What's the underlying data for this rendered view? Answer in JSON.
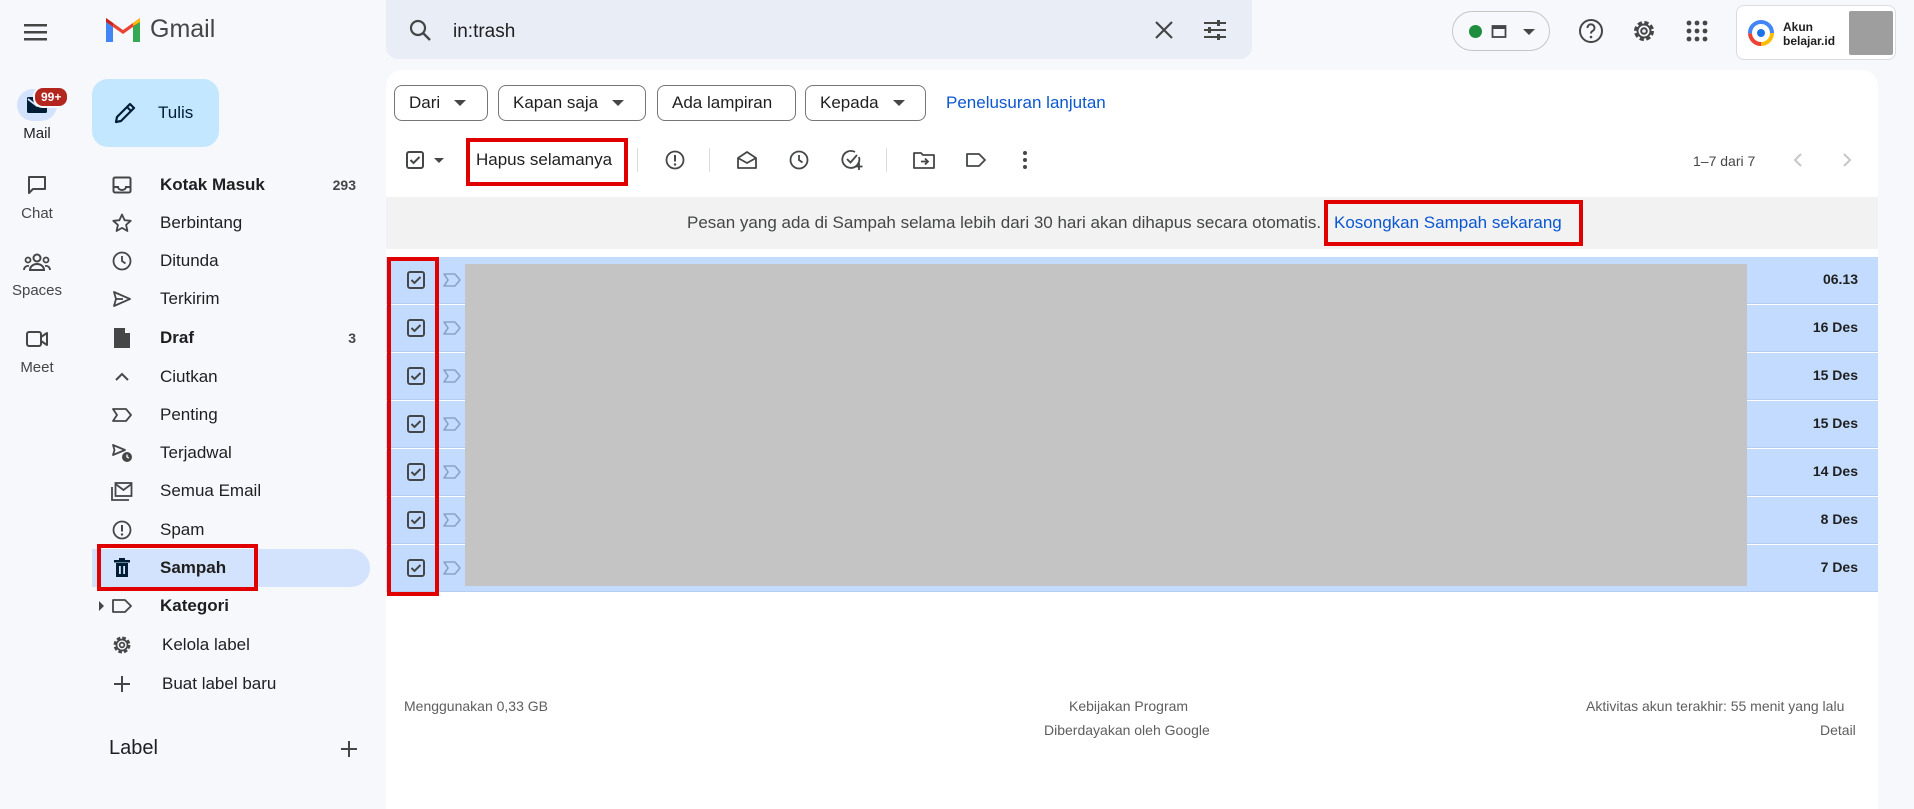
{
  "app": {
    "logo_text": "Gmail"
  },
  "search": {
    "value": "in:trash"
  },
  "account": {
    "line1": "Akun",
    "line2": "belajar.id"
  },
  "rail": [
    {
      "label": "Mail",
      "icon": "mail-icon",
      "badge": "99+"
    },
    {
      "label": "Chat",
      "icon": "chat-icon"
    },
    {
      "label": "Spaces",
      "icon": "spaces-icon"
    },
    {
      "label": "Meet",
      "icon": "meet-icon"
    }
  ],
  "compose": {
    "label": "Tulis"
  },
  "nav": {
    "inbox": {
      "label": "Kotak Masuk",
      "count": "293"
    },
    "starred": {
      "label": "Berbintang"
    },
    "snoozed": {
      "label": "Ditunda"
    },
    "sent": {
      "label": "Terkirim"
    },
    "drafts": {
      "label": "Draf",
      "count": "3"
    },
    "less": {
      "label": "Ciutkan"
    },
    "important": {
      "label": "Penting"
    },
    "scheduled": {
      "label": "Terjadwal"
    },
    "all": {
      "label": "Semua Email"
    },
    "spam": {
      "label": "Spam"
    },
    "trash": {
      "label": "Sampah"
    },
    "categories": {
      "label": "Kategori"
    },
    "manage": {
      "label": "Kelola label"
    },
    "create": {
      "label": "Buat label baru"
    }
  },
  "labels": {
    "title": "Label"
  },
  "filters": {
    "from": "Dari",
    "time": "Kapan saja",
    "attachment": "Ada lampiran",
    "to": "Kepada",
    "advanced": "Penelusuran lanjutan"
  },
  "toolbar": {
    "delete_forever": "Hapus selamanya",
    "pagination": "1–7 dari 7"
  },
  "banner": {
    "text": "Pesan yang ada di Sampah selama lebih dari 30 hari akan dihapus secara otomatis.",
    "action": "Kosongkan Sampah sekarang"
  },
  "messages": [
    {
      "date": "06.13"
    },
    {
      "date": "16 Des"
    },
    {
      "date": "15 Des"
    },
    {
      "date": "15 Des"
    },
    {
      "date": "14 Des"
    },
    {
      "date": "8 Des"
    },
    {
      "date": "7 Des"
    }
  ],
  "footer": {
    "storage": "Menggunakan 0,33 GB",
    "policy": "Kebijakan Program",
    "powered": "Diberdayakan oleh Google",
    "activity": "Aktivitas akun terakhir: 55 menit yang lalu",
    "details": "Detail"
  },
  "colors": {
    "accent": "#0b57d0",
    "selected_row": "#c2dbff",
    "active_nav": "#d3e3fd",
    "highlight": "#e00000"
  }
}
